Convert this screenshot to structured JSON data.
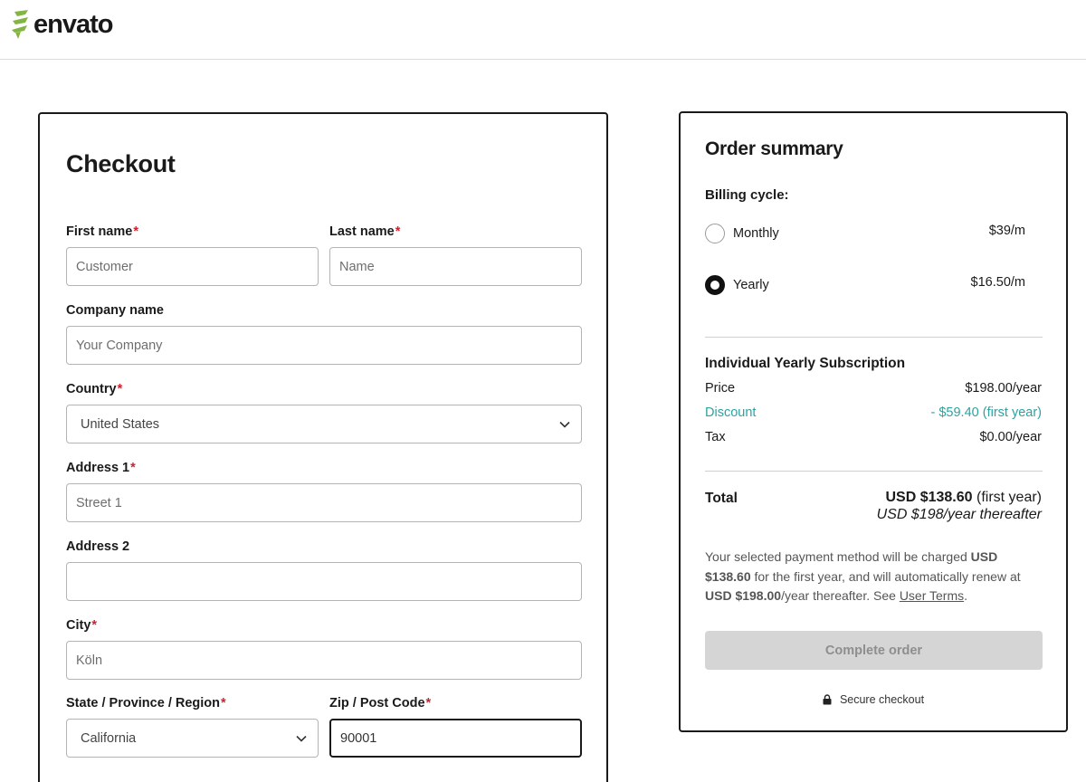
{
  "brand": {
    "name": "envato",
    "icon": "envato-leaf-icon",
    "accent": "#82b541"
  },
  "checkout": {
    "title": "Checkout",
    "fields": {
      "first_name": {
        "label": "First name",
        "required_mark": "*",
        "placeholder": "Customer",
        "value": ""
      },
      "last_name": {
        "label": "Last name",
        "required_mark": "*",
        "placeholder": "Name",
        "value": ""
      },
      "company": {
        "label": "Company name",
        "placeholder": "Your Company",
        "value": ""
      },
      "country": {
        "label": "Country",
        "required_mark": "*",
        "value": "United States"
      },
      "address1": {
        "label": "Address 1",
        "required_mark": "*",
        "placeholder": "Street 1",
        "value": ""
      },
      "address2": {
        "label": "Address 2",
        "placeholder": "",
        "value": ""
      },
      "city": {
        "label": "City",
        "required_mark": "*",
        "placeholder": "Köln",
        "value": ""
      },
      "state": {
        "label": "State / Province / Region",
        "required_mark": "*",
        "value": "California"
      },
      "zip": {
        "label": "Zip / Post Code",
        "required_mark": "*",
        "value": "90001"
      }
    }
  },
  "summary": {
    "title": "Order summary",
    "billing_cycle_label": "Billing cycle:",
    "options": [
      {
        "label": "Monthly",
        "price": "$39/m",
        "selected": false
      },
      {
        "label": "Yearly",
        "price": "$16.50/m",
        "selected": true
      }
    ],
    "subscription_title": "Individual Yearly Subscription",
    "price_label": "Price",
    "price_value": "$198.00/year",
    "discount_label": "Discount",
    "discount_value": "- $59.40 (first year)",
    "tax_label": "Tax",
    "tax_value": "$0.00/year",
    "total_label": "Total",
    "total_value": "USD $138.60",
    "total_suffix": "(first year)",
    "total_after": "USD $198/year thereafter",
    "note_part1": "Your selected payment method will be charged ",
    "note_amount1": "USD $138.60",
    "note_part2": " for the first year, and will automatically renew at ",
    "note_amount2": "USD $198.00",
    "note_part3": "/year thereafter. See ",
    "note_link": "User Terms",
    "note_end": ".",
    "complete_button": "Complete order",
    "secure_text": "Secure checkout",
    "discount_color": "#2ba3a1",
    "required_color": "#d0202e"
  }
}
